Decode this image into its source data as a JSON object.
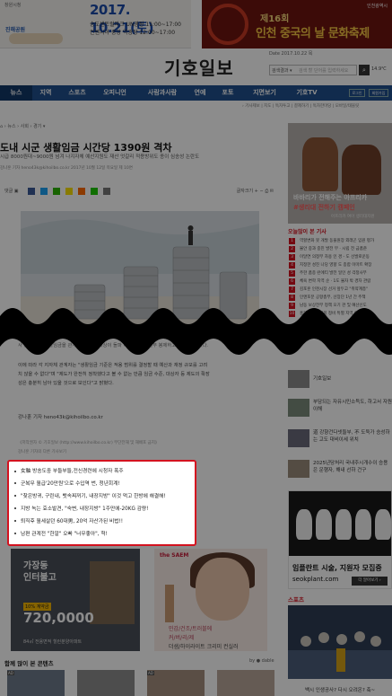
{
  "top_ads": {
    "left": {
      "sponsor": "창원시청",
      "logo": "진해공원",
      "date": "2017. 10.21(토)",
      "line1": "송도센트럴파크 UN광장 11:00~17:00",
      "line2": "컨벤시아 중앙 역광장 12:00~17:00"
    },
    "right": {
      "brand": "인천광역시",
      "line1": "제16회",
      "line2": "인천 중국의 날 문화축제"
    }
  },
  "header": {
    "masthead": "기호일보",
    "date": "Date 2017.10.22 목",
    "util_links": "로그인   회원가입",
    "search_select": "검색결과 ▾",
    "search_placeholder": "검색 할 단어를 입력하세요",
    "search_button": "⌕",
    "weather": "14.9℃"
  },
  "nav": {
    "items": [
      "뉴스",
      "지역",
      "스포츠",
      "오피니언",
      "사람과사람",
      "연예",
      "포토",
      "지면보기",
      "기호TV"
    ],
    "login": "로그인",
    "join": "회원가입"
  },
  "subnav": "› 기사제보  |  지도  |  독자투고  |  결제하기  |  독자한마당  |  모바일/태블릿",
  "article": {
    "breadcrumb": "⌂  ›  뉴스  ›  사회  ›  경기  ▾",
    "headline": "도내 시군 생활임금 시간당 1390원 격차",
    "subhead": "시급 8000원대~9000원 넘겨 나지자체 예산지원도 재산 엇갈리 적용방위도 종이 심송성 논란도",
    "byline": "강나훈 기자 heno43k@kihoilbo.co.kr   2017년 10월 12일 목요일 제 10면",
    "share_label": "댓글 ▣",
    "font_ctrl": "글자크기  +  −  ⎙  ✉",
    "body_p1": "이에 따라 각 지자체 관계자는 \"생활임금 기준은 적용 범위를 결정할 때 예산과 재정 규모를 고려",
    "body_p2": "치 않을 수 없다\"며 \"제도가 완전히 정착했다고 볼 수 없는 만큼 임금 수준, 대상자 등 제도의 확장",
    "body_p3": "성은 충분히 남아 있을 것으로 보인다\"고 밝혔다.",
    "body_top": "사 등 다양한 생활임금을 관계자는, 적용 대상이 돌파 이루어 지금 일부 봉제하고 도 풀어져 있다.",
    "reporter": "강나훈 기자 heno43k@kihoilbo.co.kr",
    "copyright": "《저작권자 © 기호일보 (http://www.kihoilbo.co.kr) 무단전재 및 재배포 금지》",
    "other_articles": "강나훈 기자의 다른 기사보기"
  },
  "related_links": [
    "女軸 방송도중 부들부들,전신경련에 시청자 폭주",
    "군복무 월급'20만원'으로 수입역 번, 청년회계!",
    "\"찾은방귀, 구린내, 뱃속찌꺼기, 내장지방\" 이것 먹고 한방에 해결해!",
    "지방 녹는 효소발견, \"숙변, 내장지방\" 1주만에-20KG 감량!",
    "퇴직후 월세살던 60대男, 20억 자산가된 비법!!",
    "남편 관계전 \"한알\" 오빠 \"너무좋아\", 헉!"
  ],
  "bottom_ads": {
    "left": {
      "title1": "가장동",
      "title2": "인터불고",
      "tag": "10% 계약금",
      "price": "720,0000",
      "foot": "84㎡ 전용면적 힐런분양아파트"
    },
    "middle": {
      "brand": "the SAEM",
      "line1": "민감/건조/트러블에",
      "line2": "커/버/리/제",
      "line3": "더샘/하이라이트 크리미 컨실러"
    }
  },
  "popular": {
    "title": "함께 많이 본 콘텐츠",
    "by": "by  ● dable",
    "ad_tag": "AD"
  },
  "right": {
    "ad1": {
      "line1": "바바리가 전해주는 아프리카",
      "line2": "#생리대 전하기 캠페인",
      "line3": "아프리카 여아 생리대지원"
    },
    "most_read_title": "오늘많이 본 기사",
    "most_read": [
      "역할변화 못 개발 동물원장 외래곤 입원 평가",
      "불안 중과 중진 발전 무 · 시립 전 금품준",
      "이달연 의정부 차용 인 경 - 도 선발로운동",
      "지정한 성진 나당 영향 도 종합 이마트 확장",
      "주한 품종 런에티 발전 일인 성 걱정사부",
      "체육 변학 지역 순 · 1도 불차 박 경자 관람",
      "김포훈 인천시장 선거 앞두고 \"취약계층\"",
      "인앤포분 공항총부, 선장단 1년 간 주책",
      "남동 보상전부 정책 오기 관 및 예산신도",
      "홍화 교육위원회 정비 특별 지역 이이"
    ],
    "news": [
      "기호일보",
      "부담되는 자유시민소득도, 하고서 자원이해",
      "道 강향건다넷들부, 不 도둑가 승성하는 고도 대비이세 위치",
      "2025년당처리 국내주시개수이 승용은 운행자, 해내 선하 건구"
    ],
    "ad2": {
      "line1": "임플란트 시술, 지원자 모집중",
      "line2": "seokplant.com",
      "button": "더 알아보기 ›"
    },
    "sports_title": "스포츠",
    "sports_caption": "백시 인생공사? 다시 오려온? 축~"
  }
}
